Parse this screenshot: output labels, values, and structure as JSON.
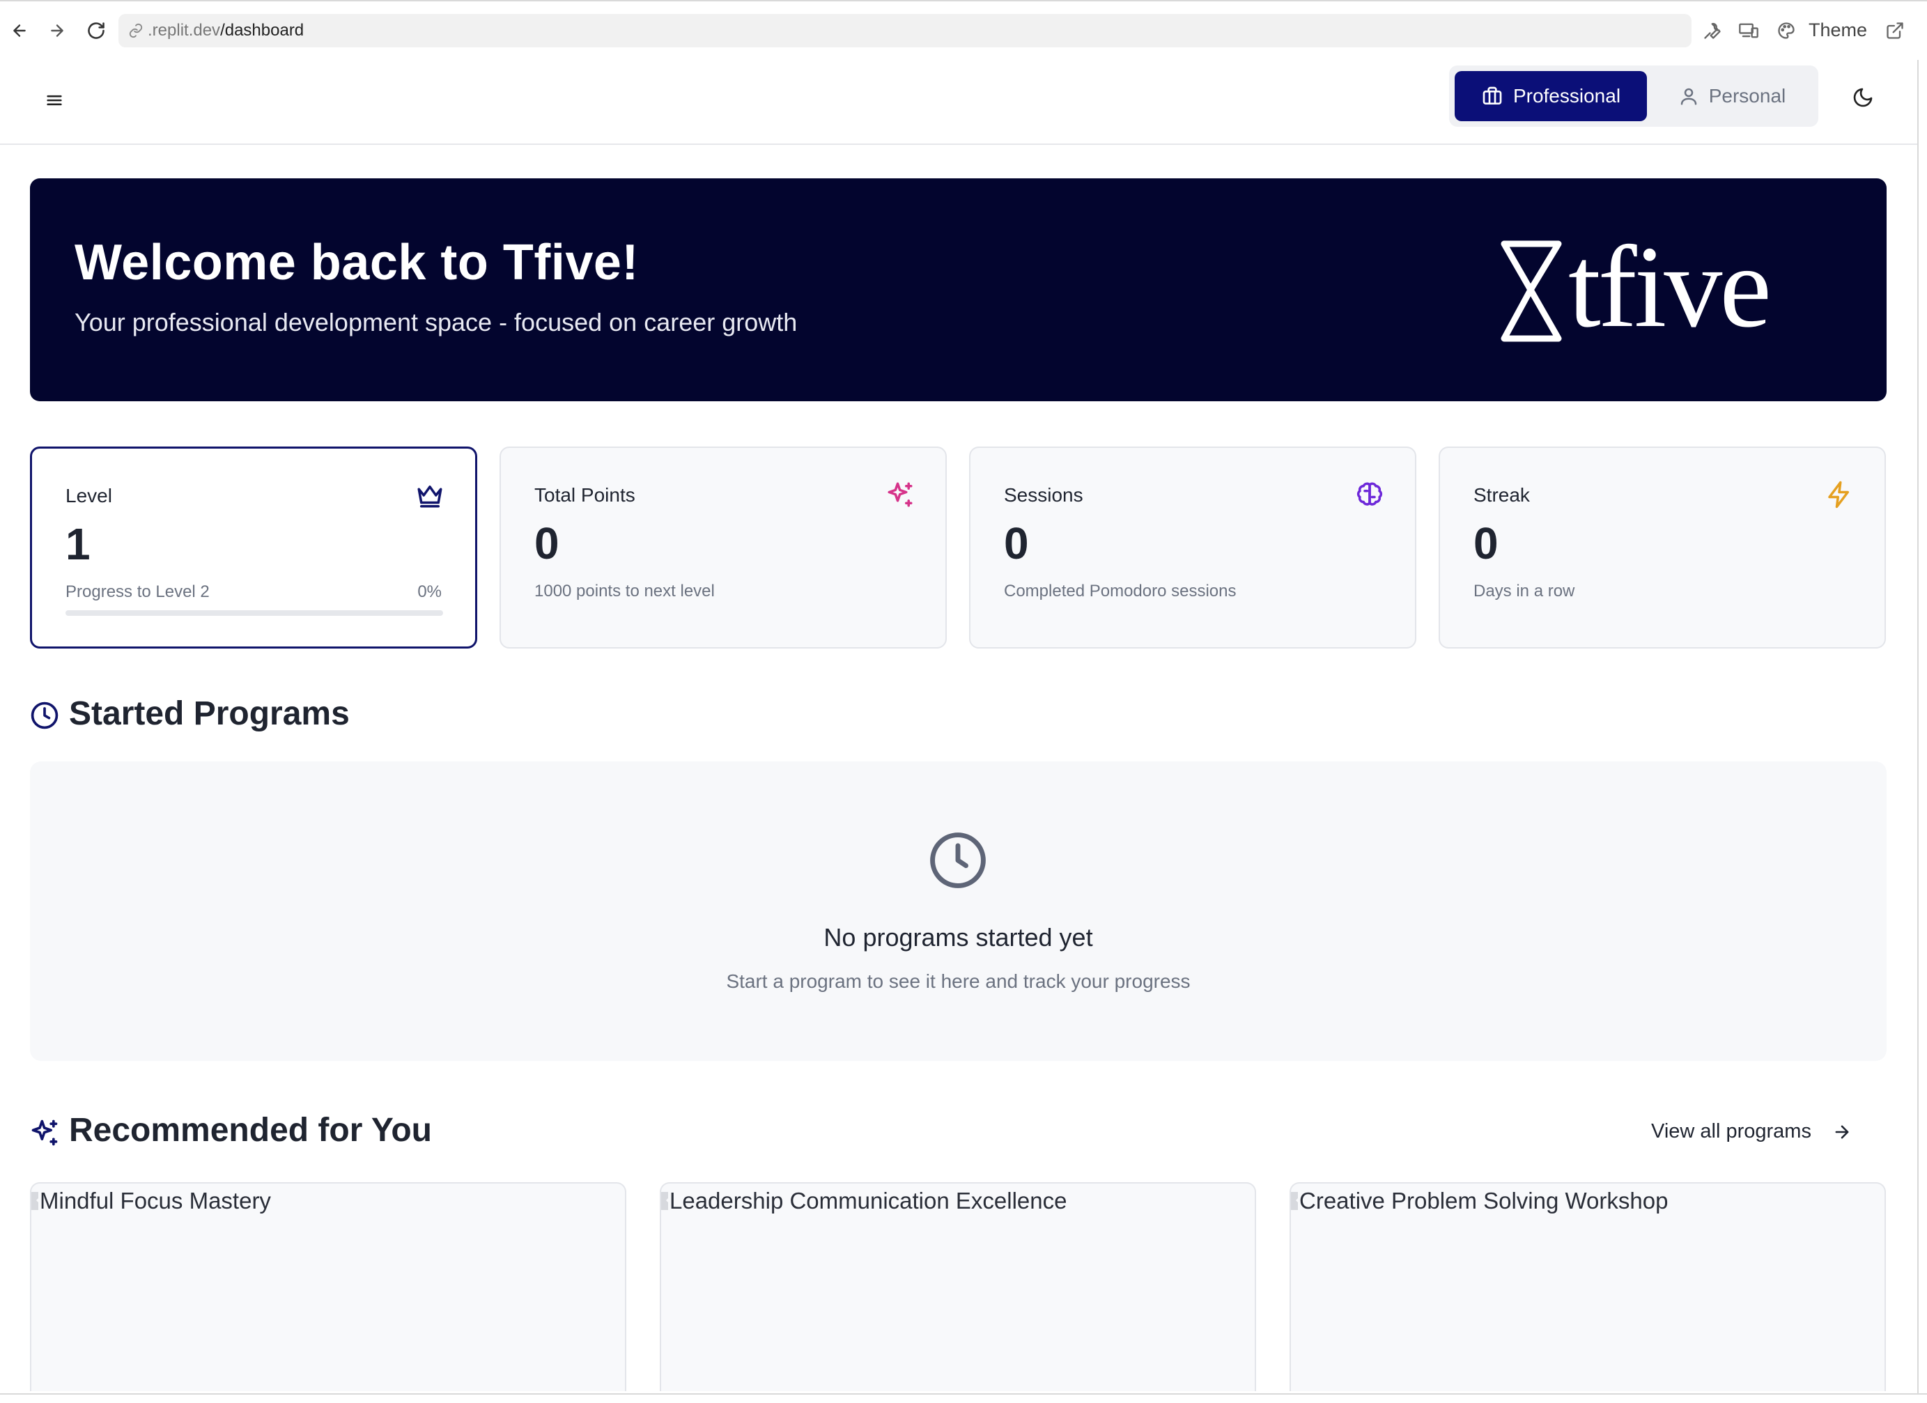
{
  "browser": {
    "url_host": ".replit.dev",
    "url_path": "/dashboard",
    "theme_label": "Theme"
  },
  "header": {
    "mode_professional": "Professional",
    "mode_personal": "Personal",
    "active_mode": "Professional"
  },
  "hero": {
    "title": "Welcome back to Tfive!",
    "subtitle": "Your professional development space - focused on career growth",
    "logo_text": "tfive"
  },
  "stats": {
    "level": {
      "label": "Level",
      "value": "1",
      "progress_label": "Progress to Level 2",
      "progress_pct": "0%",
      "progress_fraction": 0,
      "icon": "crown-icon"
    },
    "points": {
      "label": "Total Points",
      "value": "0",
      "desc": "1000 points to next level",
      "icon": "sparkles-icon"
    },
    "sessions": {
      "label": "Sessions",
      "value": "0",
      "desc": "Completed Pomodoro sessions",
      "icon": "brain-icon"
    },
    "streak": {
      "label": "Streak",
      "value": "0",
      "desc": "Days in a row",
      "icon": "zap-icon"
    }
  },
  "started": {
    "title": "Started Programs",
    "empty_title": "No programs started yet",
    "empty_desc": "Start a program to see it here and track your progress"
  },
  "recommended": {
    "title": "Recommended for You",
    "view_all": "View all programs",
    "programs": [
      {
        "alt": "Mindful Focus Mastery"
      },
      {
        "alt": "Leadership Communication Excellence"
      },
      {
        "alt": "Creative Problem Solving Workshop"
      }
    ]
  },
  "colors": {
    "brand_navy": "#0b0f78",
    "hero_bg": "#03052e",
    "points_icon": "#d6338a",
    "sessions_icon": "#6d28d9",
    "streak_icon": "#e5a020"
  }
}
